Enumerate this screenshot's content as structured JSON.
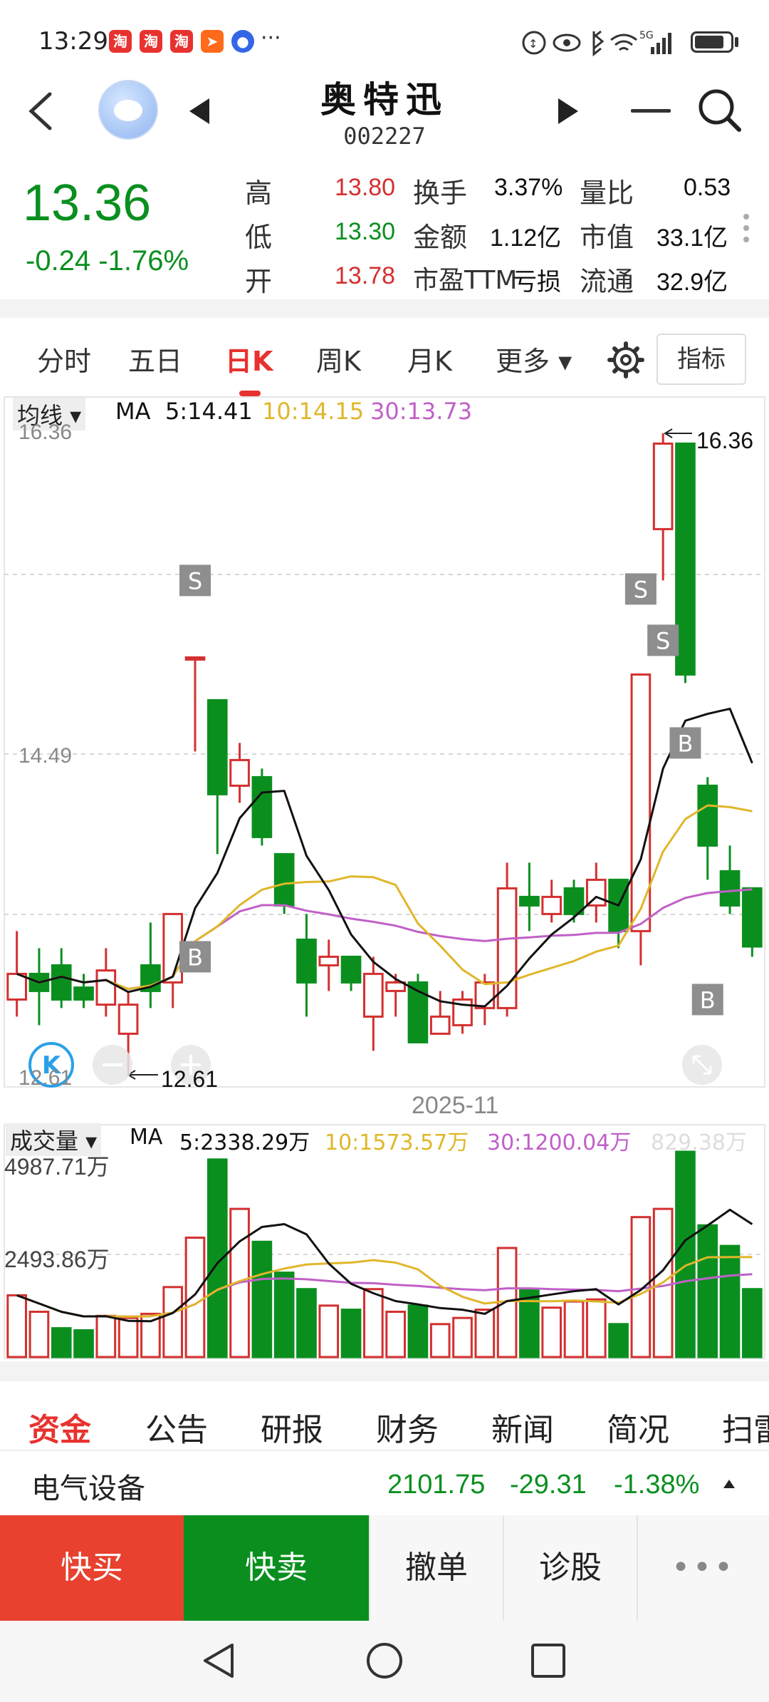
{
  "status_bar": {
    "time": "13:29",
    "app_badges": [
      "淘",
      "淘",
      "淘"
    ],
    "more": "···",
    "network": "5G"
  },
  "header": {
    "stock_name": "奥特迅",
    "stock_code": "002227"
  },
  "quote": {
    "price": "13.36",
    "change": "-0.24",
    "change_pct": "-1.76%",
    "rows": [
      {
        "l1": "高",
        "v1": "13.80",
        "l2": "换手",
        "v2": "3.37%",
        "l3": "量比",
        "v3": "0.53"
      },
      {
        "l1": "低",
        "v1": "13.30",
        "l2": "金额",
        "v2": "1.12亿",
        "l3": "市值",
        "v3": "33.1亿"
      },
      {
        "l1": "开",
        "v1": "13.78",
        "l2": "市盈TTM",
        "v2": "亏损",
        "l3": "流通",
        "v3": "32.9亿"
      }
    ]
  },
  "tabs": [
    "分时",
    "五日",
    "日K",
    "周K",
    "月K",
    "更多 ▾"
  ],
  "active_tab": "日K",
  "indicator_button": "指标",
  "kline": {
    "ma_title": "均线 ▾",
    "ma_prefix": "MA",
    "ma5": "5:14.41",
    "ma10": "10:14.15",
    "ma30": "30:13.73",
    "y_max_label": "16.36",
    "y_mid_label": "14.49",
    "y_min_label": "12.61",
    "high_marker": "16.36",
    "low_marker": "12.61",
    "date_label": "2025-11",
    "signals": [
      "S",
      "B",
      "S",
      "S",
      "B",
      "B"
    ]
  },
  "volume": {
    "title": "成交量 ▾",
    "ma_prefix": "MA",
    "ma5": "5:2338.29万",
    "ma10": "10:1573.57万",
    "ma30": "30:1200.04万",
    "current": "829.38万",
    "y_max_label": "4987.71万",
    "y_mid_label": "2493.86万"
  },
  "chart_data": {
    "type": "candlestick",
    "ylim": [
      12.61,
      16.36
    ],
    "candles": [
      {
        "o": 13.05,
        "c": 13.2,
        "h": 13.45,
        "l": 12.95,
        "up": true
      },
      {
        "o": 13.2,
        "c": 13.1,
        "h": 13.35,
        "l": 12.9,
        "up": false
      },
      {
        "o": 13.05,
        "c": 13.25,
        "h": 13.35,
        "l": 13.0,
        "up": false
      },
      {
        "o": 13.12,
        "c": 13.05,
        "h": 13.2,
        "l": 13.0,
        "up": false
      },
      {
        "o": 13.02,
        "c": 13.22,
        "h": 13.35,
        "l": 12.95,
        "up": true
      },
      {
        "o": 13.02,
        "c": 12.85,
        "h": 13.1,
        "l": 12.61,
        "up": true
      },
      {
        "o": 13.1,
        "c": 13.25,
        "h": 13.5,
        "l": 13.0,
        "up": false
      },
      {
        "o": 13.15,
        "c": 13.55,
        "h": 13.55,
        "l": 13.0,
        "up": true
      },
      {
        "o": 15.05,
        "c": 15.05,
        "h": 15.05,
        "l": 14.5,
        "up": true
      },
      {
        "o": 14.8,
        "c": 14.25,
        "h": 14.8,
        "l": 13.9,
        "up": false
      },
      {
        "o": 14.3,
        "c": 14.45,
        "h": 14.55,
        "l": 14.2,
        "up": true
      },
      {
        "o": 14.35,
        "c": 14.0,
        "h": 14.4,
        "l": 13.95,
        "up": false
      },
      {
        "o": 13.9,
        "c": 13.6,
        "h": 13.9,
        "l": 13.55,
        "up": false
      },
      {
        "o": 13.4,
        "c": 13.15,
        "h": 13.55,
        "l": 12.95,
        "up": false
      },
      {
        "o": 13.3,
        "c": 13.25,
        "h": 13.4,
        "l": 13.1,
        "up": true
      },
      {
        "o": 13.3,
        "c": 13.15,
        "h": 13.3,
        "l": 13.1,
        "up": false
      },
      {
        "o": 12.95,
        "c": 13.2,
        "h": 13.3,
        "l": 12.75,
        "up": true
      },
      {
        "o": 13.15,
        "c": 13.1,
        "h": 13.2,
        "l": 12.95,
        "up": true
      },
      {
        "o": 13.15,
        "c": 12.8,
        "h": 13.2,
        "l": 12.8,
        "up": false
      },
      {
        "o": 12.85,
        "c": 12.95,
        "h": 13.1,
        "l": 12.85,
        "up": true
      },
      {
        "o": 12.9,
        "c": 13.05,
        "h": 13.1,
        "l": 12.85,
        "up": true
      },
      {
        "o": 13.0,
        "c": 13.15,
        "h": 13.2,
        "l": 12.9,
        "up": true
      },
      {
        "o": 13.0,
        "c": 13.7,
        "h": 13.85,
        "l": 12.95,
        "up": true
      },
      {
        "o": 13.65,
        "c": 13.6,
        "h": 13.85,
        "l": 13.45,
        "up": false
      },
      {
        "o": 13.55,
        "c": 13.65,
        "h": 13.75,
        "l": 13.5,
        "up": true
      },
      {
        "o": 13.7,
        "c": 13.55,
        "h": 13.75,
        "l": 13.5,
        "up": false
      },
      {
        "o": 13.6,
        "c": 13.75,
        "h": 13.85,
        "l": 13.5,
        "up": true
      },
      {
        "o": 13.75,
        "c": 13.45,
        "h": 13.75,
        "l": 13.35,
        "up": false
      },
      {
        "o": 13.45,
        "c": 14.95,
        "h": 14.95,
        "l": 13.25,
        "up": true
      },
      {
        "o": 15.8,
        "c": 16.3,
        "h": 16.36,
        "l": 15.5,
        "up": true
      },
      {
        "o": 16.3,
        "c": 14.95,
        "h": 16.3,
        "l": 14.9,
        "up": false
      },
      {
        "o": 14.3,
        "c": 13.95,
        "h": 14.35,
        "l": 13.75,
        "up": false
      },
      {
        "o": 13.8,
        "c": 13.6,
        "h": 13.95,
        "l": 13.55,
        "up": false
      },
      {
        "o": 13.7,
        "c": 13.36,
        "h": 13.7,
        "l": 13.3,
        "up": false
      }
    ],
    "volumes": [
      {
        "v": 1500,
        "up": true
      },
      {
        "v": 1100,
        "up": true
      },
      {
        "v": 700,
        "up": false
      },
      {
        "v": 650,
        "up": false
      },
      {
        "v": 1000,
        "up": true
      },
      {
        "v": 950,
        "up": true
      },
      {
        "v": 1050,
        "up": true
      },
      {
        "v": 1700,
        "up": true
      },
      {
        "v": 2900,
        "up": true
      },
      {
        "v": 4800,
        "up": false
      },
      {
        "v": 3600,
        "up": true
      },
      {
        "v": 2800,
        "up": false
      },
      {
        "v": 2050,
        "up": false
      },
      {
        "v": 1650,
        "up": false
      },
      {
        "v": 1250,
        "up": true
      },
      {
        "v": 1150,
        "up": false
      },
      {
        "v": 1650,
        "up": true
      },
      {
        "v": 1100,
        "up": true
      },
      {
        "v": 1250,
        "up": false
      },
      {
        "v": 800,
        "up": true
      },
      {
        "v": 950,
        "up": true
      },
      {
        "v": 1150,
        "up": true
      },
      {
        "v": 2650,
        "up": true
      },
      {
        "v": 1650,
        "up": false
      },
      {
        "v": 1200,
        "up": true
      },
      {
        "v": 1350,
        "up": true
      },
      {
        "v": 1400,
        "up": true
      },
      {
        "v": 800,
        "up": false
      },
      {
        "v": 3400,
        "up": true
      },
      {
        "v": 3600,
        "up": true
      },
      {
        "v": 4987.71,
        "up": false
      },
      {
        "v": 3200,
        "up": false
      },
      {
        "v": 2700,
        "up": false
      },
      {
        "v": 1650,
        "up": false
      }
    ]
  },
  "info_tabs": [
    "资金",
    "公告",
    "研报",
    "财务",
    "新闻",
    "简况",
    "扫雷"
  ],
  "sector": {
    "name": "电气设备",
    "price": "2101.75",
    "change": "-29.31",
    "change_pct": "-1.38%"
  },
  "actions": {
    "buy": "快买",
    "sell": "快卖",
    "cancel": "撤单",
    "diagnose": "诊股",
    "more": "•••"
  },
  "colors": {
    "up": "#d3302f",
    "down": "#0a8f1f",
    "ma5": "#111111",
    "ma10": "#e0b62a",
    "ma30": "#c060c8"
  }
}
